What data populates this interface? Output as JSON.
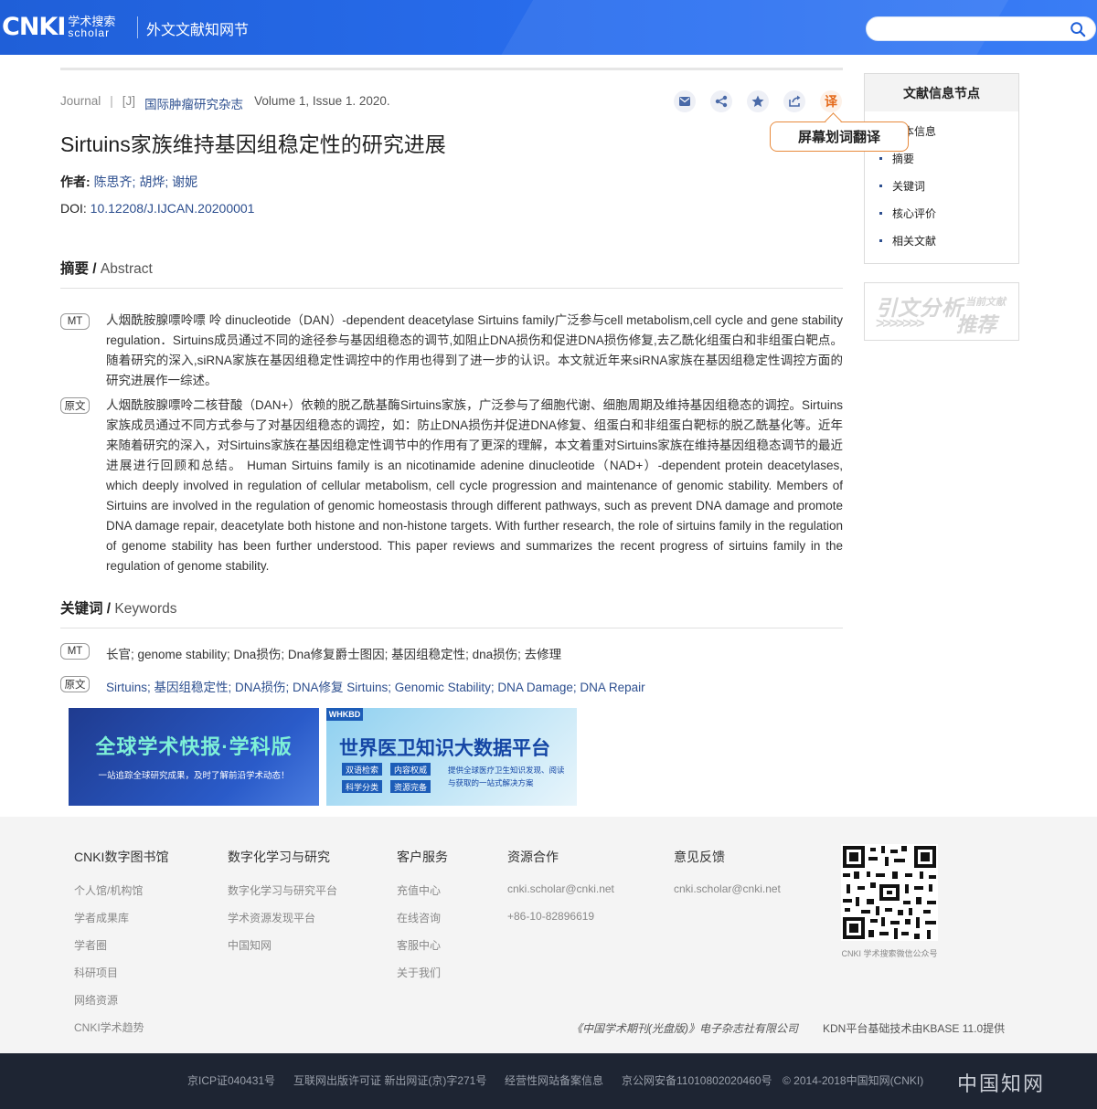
{
  "header": {
    "logo_main": "CNKI",
    "logo_cn": "学术搜索",
    "logo_en": "scholar",
    "title": "外文文献知网节",
    "search_placeholder": ""
  },
  "article": {
    "type": "Journal",
    "sep": "|",
    "code": "[J]",
    "journal": "国际肿瘤研究杂志",
    "volume": "Volume 1, Issue 1. 2020.",
    "translate_label": "译",
    "translate_tooltip": "屏幕划词翻译",
    "title": "Sirtuins家族维持基因组稳定性的研究进展",
    "authors_label": "作者:",
    "authors": "陈思齐; 胡烨; 谢妮",
    "doi_label": "DOI:",
    "doi": "10.12208/J.IJCAN.20200001"
  },
  "abstract": {
    "heading_cn": "摘要 /",
    "heading_en": " Abstract",
    "mt_tag": "MT",
    "mt_text": "人烟酰胺腺嘌呤嘌 呤 dinucleotide（DAN）-dependent deacetylase Sirtuins family广泛参与cell metabolism,cell cycle and gene stability regulation．Sirtuins成员通过不同的途径参与基因组稳态的调节,如阻止DNA损伤和促进DNA损伤修复,去乙酰化组蛋白和非组蛋白靶点。随着研究的深入,siRNA家族在基因组稳定性调控中的作用也得到了进一步的认识。本文就近年来siRNA家族在基因组稳定性调控方面的研究进展作一综述。",
    "orig_tag": "原文",
    "orig_text": "人烟酰胺腺嘌呤二核苷酸（DAN+）依赖的脱乙酰基酶Sirtuins家族，广泛参与了细胞代谢、细胞周期及维持基因组稳态的调控。Sirtuins家族成员通过不同方式参与了对基因组稳态的调控，如：防止DNA损伤并促进DNA修复、组蛋白和非组蛋白靶标的脱乙酰基化等。近年来随着研究的深入，对Sirtuins家族在基因组稳定性调节中的作用有了更深的理解，本文着重对Sirtuins家族在维持基因组稳态调节的最近进展进行回顾和总结。 Human Sirtuins family is an nicotinamide adenine dinucleotide（NAD+）-dependent protein deacetylases, which deeply involved in regulation of cellular metabolism, cell cycle progression and maintenance of genomic stability. Members of Sirtuins are involved in the regulation of genomic homeostasis through different pathways, such as prevent DNA damage and promote DNA damage repair, deacetylate both histone and non-histone targets. With further research, the role of sirtuins family in the regulation of genome stability has been further understood. This paper reviews and summarizes the recent progress of sirtuins family in the regulation of genome stability."
  },
  "keywords": {
    "heading_cn": "关键词 /",
    "heading_en": " Keywords",
    "mt_tag": "MT",
    "mt_text": "长官; genome stability; Dna损伤; Dna修复爵士图因; 基因组稳定性; dna损伤; 去修理",
    "orig_tag": "原文",
    "orig_text": "Sirtuins; 基因组稳定性; DNA损伤; DNA修复 Sirtuins; Genomic Stability; DNA Damage; DNA Repair"
  },
  "banners": {
    "b1_title": "全球学术快报·学科版",
    "b1_sub": "一站追踪全球研究成果，及时了解前沿学术动态！",
    "b2_badge": "WHKBD",
    "b2_title": "世界医卫知识大数据平台",
    "b2_chips": [
      "双语检索",
      "内容权威",
      "科学分类",
      "资源完备"
    ],
    "b2_desc": "提供全球医疗卫生知识发现、阅读与获取的一站式解决方案"
  },
  "sidebar": {
    "title": "文献信息节点",
    "items": [
      "基本信息",
      "摘要",
      "关键词",
      "核心评价",
      "相关文献"
    ],
    "promo_a": "引文分析",
    "promo_b": "当前文献",
    "promo_c": ">>>>>>>",
    "promo_d": "推荐"
  },
  "footer": {
    "col1": {
      "title": "CNKI数字图书馆",
      "links": [
        "个人馆/机构馆",
        "学者成果库",
        "学者圈",
        "科研项目",
        "网络资源",
        "CNKI学术趋势"
      ]
    },
    "col2": {
      "title": "数字化学习与研究",
      "links": [
        "数字化学习与研究平台",
        "学术资源发现平台",
        "中国知网"
      ]
    },
    "col3": {
      "title": "客户服务",
      "links": [
        "充值中心",
        "在线咨询",
        "客服中心",
        "关于我们"
      ]
    },
    "col4": {
      "title": "资源合作",
      "links": [
        "cnki.scholar@cnki.net",
        "+86-10-82896619"
      ]
    },
    "col5": {
      "title": "意见反馈",
      "links": [
        "cnki.scholar@cnki.net"
      ]
    },
    "qr_caption": "CNKI 学术搜索微信公众号",
    "publisher": "《中国学术期刊(光盘版)》电子杂志社有限公司",
    "kbase": "KDN平台基础技术由KBASE 11.0提供"
  },
  "bottom": {
    "icp": "京ICP证040431号",
    "publish": "互联网出版许可证 新出网证(京)字271号",
    "record": "经营性网站备案信息",
    "police": "京公网安备11010802020460号",
    "copyright": "© 2014-2018中国知网(CNKI)",
    "logo": "中国知网"
  }
}
